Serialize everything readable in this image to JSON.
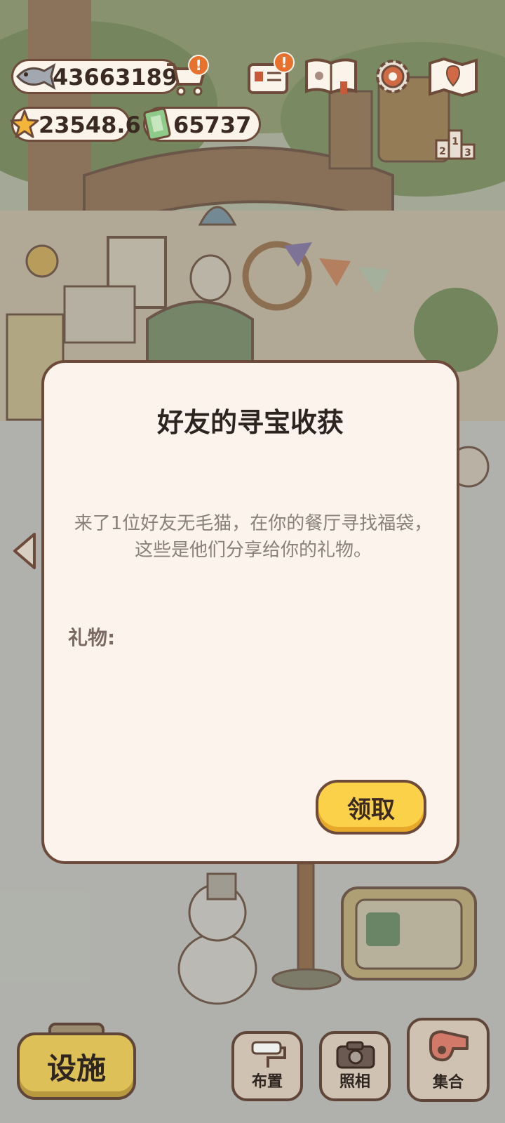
{
  "hud": {
    "fish_coins": "43663189",
    "stars": "23548.6",
    "tickets": "65737",
    "shop_badge": "!",
    "mail_badge": "!",
    "ranking_digits": [
      "2",
      "1",
      "3"
    ]
  },
  "dialog": {
    "title": "好友的寻宝收获",
    "message": "来了1位好友无毛猫，在你的餐厅寻找福袋，这些是他们分享给你的礼物。",
    "gift_label": "礼物:",
    "claim_label": "领取"
  },
  "bottom_bar": {
    "facility_label": "设施",
    "layout_label": "布置",
    "photo_label": "照相",
    "gather_label": "集合"
  },
  "colors": {
    "accent_yellow": "#fbd14a",
    "outline_brown": "#6d4a3a",
    "badge_orange": "#e8712e",
    "dialog_bg": "#fcf4ec"
  },
  "icons": [
    "fish-icon",
    "cart-icon",
    "star-icon",
    "ticket-icon",
    "mail-icon",
    "book-icon",
    "gear-icon",
    "map-icon",
    "podium-icon",
    "roller-icon",
    "camera-icon",
    "whistle-icon",
    "chevron-left-icon"
  ]
}
